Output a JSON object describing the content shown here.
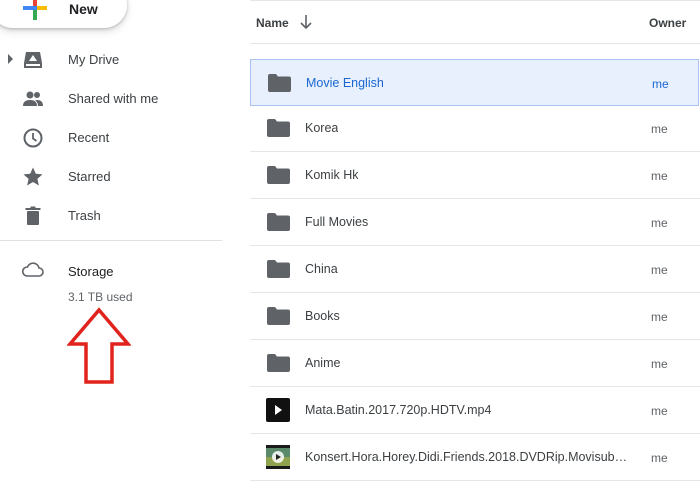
{
  "new_button": {
    "label": "New"
  },
  "sidebar": {
    "items": [
      {
        "label": "My Drive",
        "icon": "my-drive-icon"
      },
      {
        "label": "Shared with me",
        "icon": "shared-people-icon"
      },
      {
        "label": "Recent",
        "icon": "clock-icon"
      },
      {
        "label": "Starred",
        "icon": "star-icon"
      },
      {
        "label": "Trash",
        "icon": "trash-icon"
      }
    ],
    "storage": {
      "title": "Storage",
      "used": "3.1 TB used",
      "icon": "cloud-icon"
    }
  },
  "list": {
    "header": {
      "name": "Name",
      "owner": "Owner"
    },
    "rows": [
      {
        "name": "Movie English",
        "owner": "me",
        "type": "folder",
        "selected": true
      },
      {
        "name": "Korea",
        "owner": "me",
        "type": "folder"
      },
      {
        "name": "Komik Hk",
        "owner": "me",
        "type": "folder"
      },
      {
        "name": "Full Movies",
        "owner": "me",
        "type": "folder"
      },
      {
        "name": "China",
        "owner": "me",
        "type": "folder"
      },
      {
        "name": "Books",
        "owner": "me",
        "type": "folder"
      },
      {
        "name": "Anime",
        "owner": "me",
        "type": "folder"
      },
      {
        "name": "Mata.Batin.2017.720p.HDTV.mp4",
        "owner": "me",
        "type": "video"
      },
      {
        "name": "Konsert.Hora.Horey.Didi.Friends.2018.DVDRip.Movisubm...",
        "owner": "me",
        "type": "video-thumb"
      }
    ]
  },
  "colors": {
    "selected_bg": "#e8f0fe",
    "selected_text": "#1967d2",
    "annotation_arrow": "#e0231c"
  }
}
